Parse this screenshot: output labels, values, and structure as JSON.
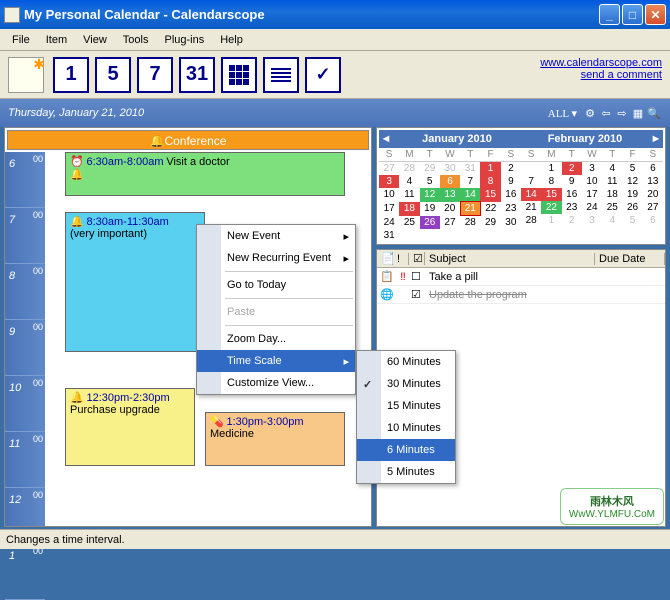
{
  "window": {
    "title": "My Personal Calendar - Calendarscope"
  },
  "menu": {
    "file": "File",
    "item": "Item",
    "view": "View",
    "tools": "Tools",
    "plugins": "Plug-ins",
    "help": "Help"
  },
  "toolbar": {
    "views": [
      "1",
      "5",
      "7",
      "31"
    ],
    "link1": "www.calendarscope.com",
    "link2": "send a comment"
  },
  "dateheader": {
    "date": "Thursday, January 21, 2010",
    "all": "ALL ▾"
  },
  "banner": "🔔Conference",
  "hours": [
    "6",
    "7",
    "8",
    "9",
    "10",
    "11",
    "12",
    "1"
  ],
  "appts": {
    "a1": {
      "time": "6:30am-8:00am",
      "text": "Visit a doctor"
    },
    "a2": {
      "time": "8:30am-11:30am",
      "text": "(very important)"
    },
    "a3": {
      "time": "12:30pm-2:30pm",
      "text": "Purchase upgrade"
    },
    "a4": {
      "time": "1:30pm-3:00pm",
      "text": "Medicine"
    }
  },
  "ctx": {
    "new_event": "New Event",
    "new_rec": "New Recurring Event",
    "goto": "Go to Today",
    "paste": "Paste",
    "zoom": "Zoom Day...",
    "timescale": "Time Scale",
    "customize": "Customize View...",
    "m60": "60 Minutes",
    "m30": "30 Minutes",
    "m15": "15 Minutes",
    "m10": "10 Minutes",
    "m6": "6 Minutes",
    "m5": "5 Minutes"
  },
  "minical": {
    "jan": "January 2010",
    "feb": "February 2010",
    "dow": [
      "S",
      "M",
      "T",
      "W",
      "T",
      "F",
      "S"
    ]
  },
  "tasks": {
    "head_subject": "Subject",
    "head_due": "Due Date",
    "t1": "Take a pill",
    "t2": "Update the program"
  },
  "status": "Changes a time interval.",
  "watermark": {
    "cn": "雨林木风",
    "url": "WwW.YLMFU.CoM"
  }
}
